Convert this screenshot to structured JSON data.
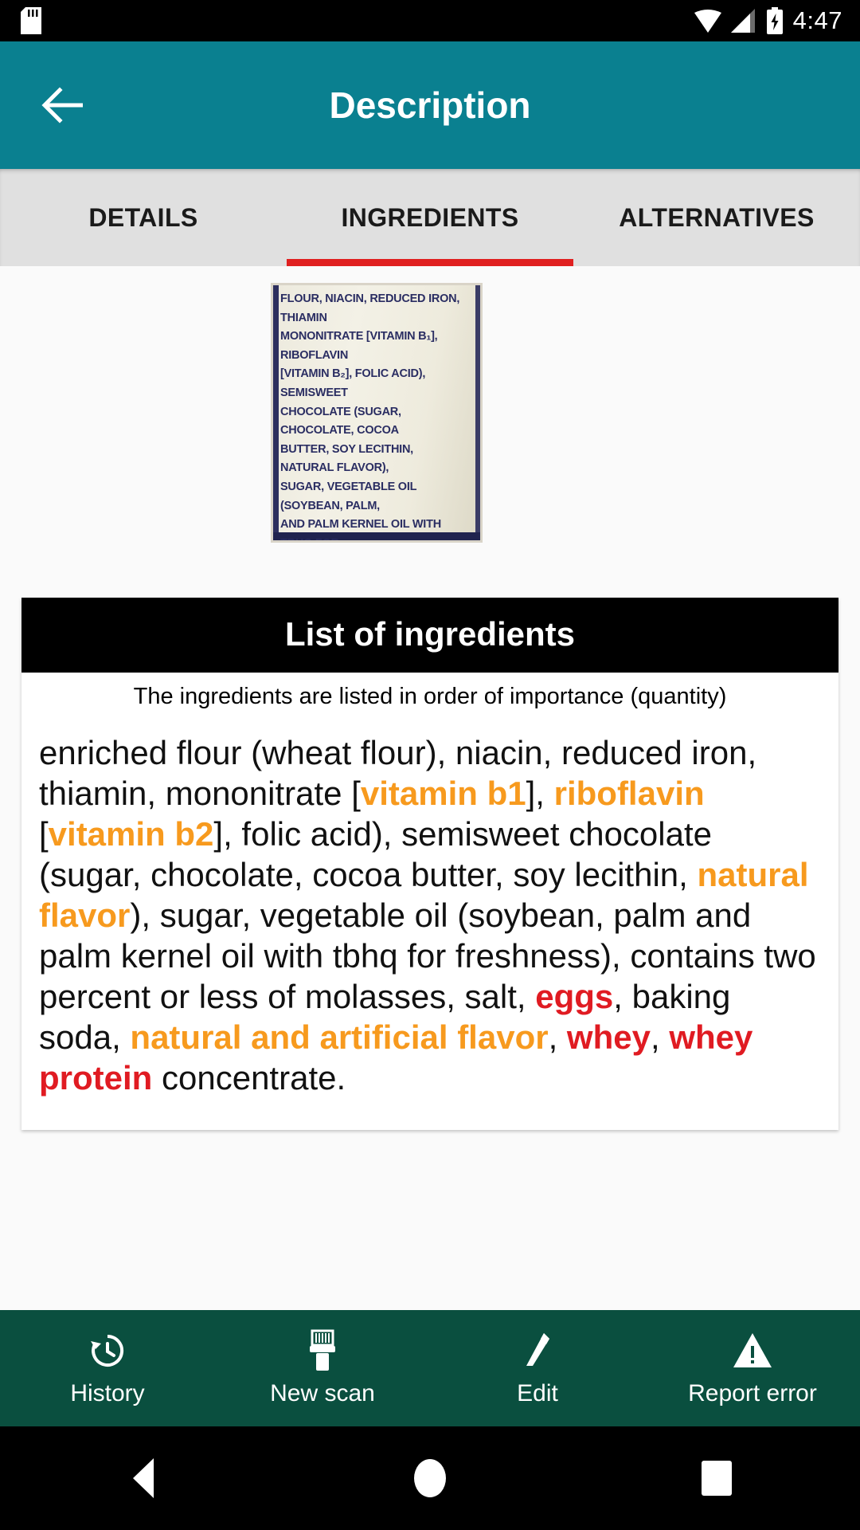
{
  "status_bar": {
    "time": "4:47",
    "icons": [
      "sd-card-icon",
      "wifi-icon",
      "signal-icon",
      "battery-charging-icon"
    ]
  },
  "app_bar": {
    "back_icon": "arrow-left-icon",
    "title": "Description",
    "color": "#0a8090"
  },
  "tabs": {
    "items": [
      {
        "label": "DETAILS",
        "active": false
      },
      {
        "label": "INGREDIENTS",
        "active": true
      },
      {
        "label": "ALTERNATIVES",
        "active": false
      }
    ],
    "indicator_color": "#e02020",
    "bar_color": "#e0e0e0"
  },
  "product_photo": {
    "alt": "ingredients-label-photo",
    "ocr_text": "FLOUR, NIACIN, REDUCED IRON, THIAMIN\nMONONITRATE [VITAMIN B₁], RIBOFLAVIN\n[VITAMIN B₂], FOLIC ACID), SEMISWEET\nCHOCOLATE (SUGAR, CHOCOLATE, COCOA\nBUTTER, SOY LECITHIN, NATURAL FLAVOR),\nSUGAR, VEGETABLE OIL (SOYBEAN, PALM,\nAND PALM KERNEL OIL WITH TBHQ FOR\nFRESHNESS), CONTAINS TWO PERCENT OR\nLESS OF MOLASSES, SALT, EGGS, BAKING\nSODA, NATURAL AND ARTIFICIAL FLAVOR,\nWHEY, WHEY PROTEIN CONCENTRATE."
  },
  "ingredients_card": {
    "header": "List of ingredients",
    "subtitle": "The ingredients are listed in order of importance (quantity)",
    "highlight_colors": {
      "additive": "#f79a1e",
      "allergen": "#e01b22"
    },
    "segments": [
      {
        "text": "enriched flour (wheat flour), niacin, reduced iron, thiamin, mononitrate [",
        "style": "plain"
      },
      {
        "text": "vitamin b1",
        "style": "additive"
      },
      {
        "text": "], ",
        "style": "plain"
      },
      {
        "text": "riboflavin",
        "style": "additive"
      },
      {
        "text": " [",
        "style": "plain"
      },
      {
        "text": "vitamin b2",
        "style": "additive"
      },
      {
        "text": "], folic acid), semisweet chocolate (sugar, chocolate, cocoa butter, soy lecithin, ",
        "style": "plain"
      },
      {
        "text": "natural flavor",
        "style": "additive"
      },
      {
        "text": "), sugar, vegetable oil (soybean, palm and palm kernel oil with tbhq for freshness), contains two percent or less of molasses, salt, ",
        "style": "plain"
      },
      {
        "text": "eggs",
        "style": "allergen"
      },
      {
        "text": ", baking soda, ",
        "style": "plain"
      },
      {
        "text": "natural and artificial flavor",
        "style": "additive"
      },
      {
        "text": ", ",
        "style": "plain"
      },
      {
        "text": "whey",
        "style": "allergen"
      },
      {
        "text": ", ",
        "style": "plain"
      },
      {
        "text": "whey protein",
        "style": "allergen"
      },
      {
        "text": " concentrate.",
        "style": "plain"
      }
    ]
  },
  "bottom_nav": {
    "background": "#0a4f3f",
    "items": [
      {
        "label": "History",
        "icon": "history-clock-icon"
      },
      {
        "label": "New scan",
        "icon": "barcode-scanner-icon"
      },
      {
        "label": "Edit",
        "icon": "pencil-icon"
      },
      {
        "label": "Report error",
        "icon": "warning-triangle-icon"
      }
    ]
  },
  "android_nav": {
    "buttons": [
      "back-triangle-icon",
      "home-circle-icon",
      "recents-square-icon"
    ]
  }
}
